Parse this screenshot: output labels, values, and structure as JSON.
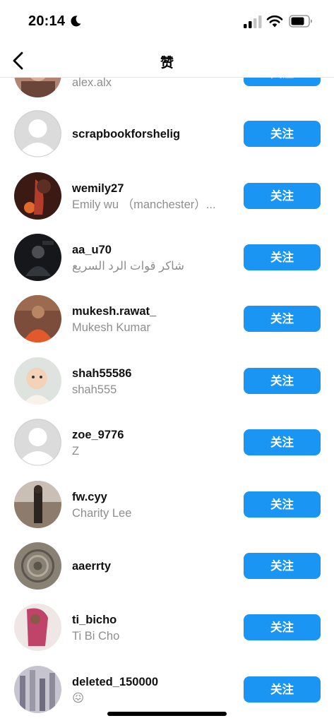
{
  "status_bar": {
    "time": "20:14"
  },
  "nav": {
    "title": "赞"
  },
  "follow_label": "关注",
  "rows": [
    {
      "username": "",
      "fullname": "alex.alx",
      "avatar": "photo"
    },
    {
      "username": "scrapbookforshelig",
      "fullname": "",
      "avatar": "placeholder"
    },
    {
      "username": "wemily27",
      "fullname": "Emily wu （manchester）...",
      "avatar": "photo"
    },
    {
      "username": "aa_u70",
      "fullname": "شاكر قوات الرد السريع",
      "avatar": "photo"
    },
    {
      "username": "mukesh.rawat_",
      "fullname": "Mukesh Kumar",
      "avatar": "photo"
    },
    {
      "username": "shah55586",
      "fullname": "shah555",
      "avatar": "photo"
    },
    {
      "username": "zoe_9776",
      "fullname": "Z",
      "avatar": "placeholder"
    },
    {
      "username": "fw.cyy",
      "fullname": "Charity Lee",
      "avatar": "photo"
    },
    {
      "username": "aaerrty",
      "fullname": "",
      "avatar": "photo"
    },
    {
      "username": "ti_bicho",
      "fullname": "Ti Bi Cho",
      "avatar": "photo"
    },
    {
      "username": "deleted_150000",
      "fullname": "😖",
      "avatar": "photo"
    }
  ],
  "colors": {
    "accent": "#1a95f3",
    "secondary_text": "#8e8e8e"
  }
}
